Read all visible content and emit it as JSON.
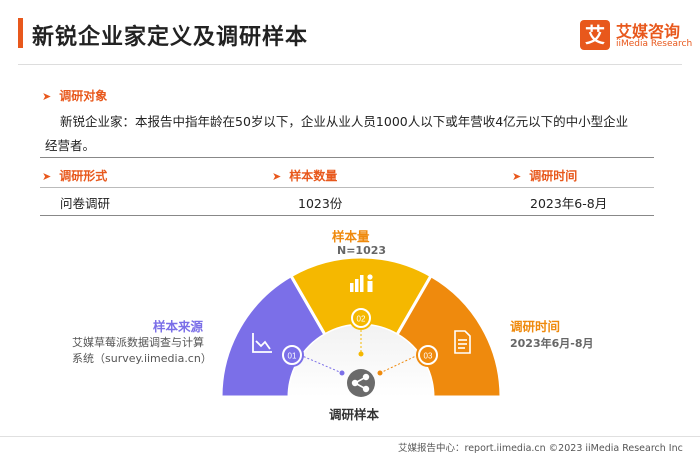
{
  "title": "新锐企业家定义及调研样本",
  "logo": {
    "mark": "艾",
    "cn": "艾媒咨询",
    "en": "iiMedia Research"
  },
  "object": {
    "heading": "调研对象",
    "text_line1": "新锐企业家：本报告中指年龄在50岁以下，企业从业人员1000人以下或年营收4亿元以下的中小型企业",
    "text_line2": "经营者。"
  },
  "table": {
    "headers": [
      "调研形式",
      "样本数量",
      "调研时间"
    ],
    "values": [
      "问卷调研",
      "1023份",
      "2023年6-8月"
    ]
  },
  "gauge": {
    "center_label": "调研样本",
    "segments": [
      {
        "num": "01",
        "title": "样本来源",
        "desc_line1": "艾媒草莓派数据调查与计算",
        "desc_line2": "系统（survey.iimedia.cn）",
        "color": "#7b6fe8",
        "icon": "chart-line-icon"
      },
      {
        "num": "02",
        "title": "样本量",
        "desc_line1": "N=1023",
        "color": "#f5b800",
        "icon": "people-growth-icon"
      },
      {
        "num": "03",
        "title": "调研时间",
        "desc_line1": "2023年6月-8月",
        "color": "#ef8a0d",
        "icon": "document-icon"
      }
    ]
  },
  "footer": "艾媒报告中心：report.iimedia.cn  ©2023  iiMedia Research  Inc",
  "colors": {
    "accent": "#e8581c"
  }
}
